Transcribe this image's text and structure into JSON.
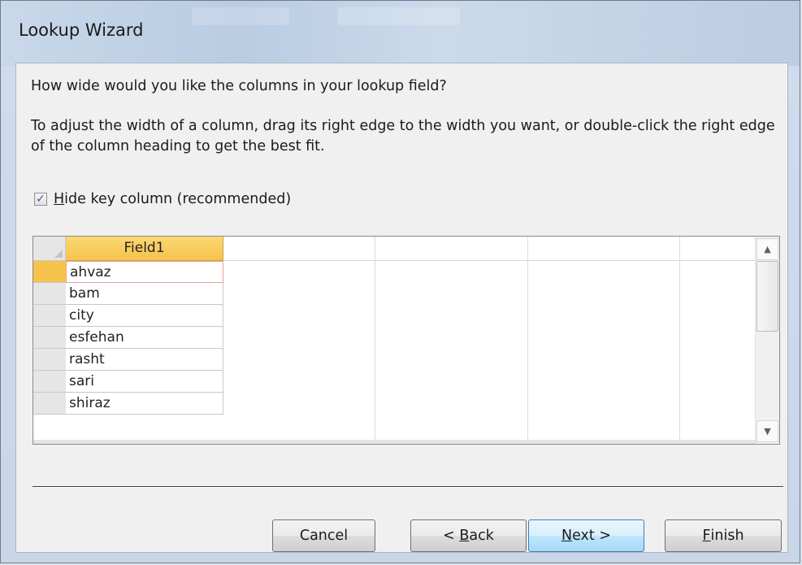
{
  "window": {
    "title": "Lookup Wizard"
  },
  "prompt": {
    "question": "How wide would you like the columns in your lookup field?",
    "instruction": "To adjust the width of a column, drag its right edge to the width you want, or double-click the right edge of the column heading to get the best fit."
  },
  "hide_key": {
    "checked": true,
    "mnemonic": "H",
    "label_rest": "ide key column (recommended)"
  },
  "grid": {
    "column_header": "Field1",
    "rows": [
      "ahvaz",
      "bam",
      "city",
      "esfehan",
      "rasht",
      "sari",
      "shiraz"
    ],
    "active_row": 0
  },
  "buttons": {
    "cancel": "Cancel",
    "back_prefix": "< ",
    "back_mnemonic": "B",
    "back_rest": "ack",
    "next_mnemonic": "N",
    "next_rest": "ext >",
    "finish_mnemonic": "F",
    "finish_rest": "inish"
  },
  "icons": {
    "checkbox": "checkmark-icon",
    "scroll_up": "scroll-up-arrow-icon",
    "scroll_down": "scroll-down-arrow-icon"
  }
}
